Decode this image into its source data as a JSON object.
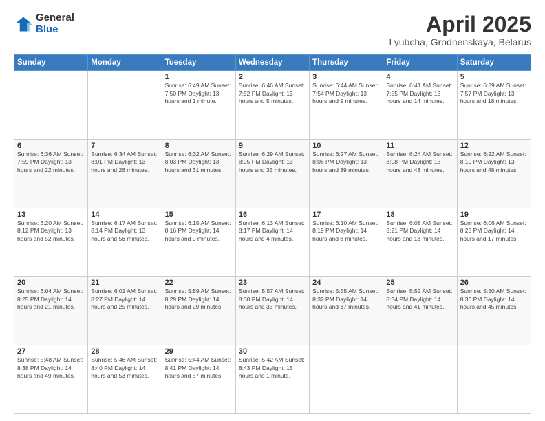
{
  "header": {
    "logo_general": "General",
    "logo_blue": "Blue",
    "title": "April 2025",
    "subtitle": "Lyubcha, Grodnenskaya, Belarus"
  },
  "days_of_week": [
    "Sunday",
    "Monday",
    "Tuesday",
    "Wednesday",
    "Thursday",
    "Friday",
    "Saturday"
  ],
  "weeks": [
    [
      {
        "day": "",
        "info": ""
      },
      {
        "day": "",
        "info": ""
      },
      {
        "day": "1",
        "info": "Sunrise: 6:49 AM\nSunset: 7:50 PM\nDaylight: 13 hours and 1 minute."
      },
      {
        "day": "2",
        "info": "Sunrise: 6:46 AM\nSunset: 7:52 PM\nDaylight: 13 hours and 5 minutes."
      },
      {
        "day": "3",
        "info": "Sunrise: 6:44 AM\nSunset: 7:54 PM\nDaylight: 13 hours and 9 minutes."
      },
      {
        "day": "4",
        "info": "Sunrise: 6:41 AM\nSunset: 7:55 PM\nDaylight: 13 hours and 14 minutes."
      },
      {
        "day": "5",
        "info": "Sunrise: 6:39 AM\nSunset: 7:57 PM\nDaylight: 13 hours and 18 minutes."
      }
    ],
    [
      {
        "day": "6",
        "info": "Sunrise: 6:36 AM\nSunset: 7:59 PM\nDaylight: 13 hours and 22 minutes."
      },
      {
        "day": "7",
        "info": "Sunrise: 6:34 AM\nSunset: 8:01 PM\nDaylight: 13 hours and 26 minutes."
      },
      {
        "day": "8",
        "info": "Sunrise: 6:32 AM\nSunset: 8:03 PM\nDaylight: 13 hours and 31 minutes."
      },
      {
        "day": "9",
        "info": "Sunrise: 6:29 AM\nSunset: 8:05 PM\nDaylight: 13 hours and 35 minutes."
      },
      {
        "day": "10",
        "info": "Sunrise: 6:27 AM\nSunset: 8:06 PM\nDaylight: 13 hours and 39 minutes."
      },
      {
        "day": "11",
        "info": "Sunrise: 6:24 AM\nSunset: 8:08 PM\nDaylight: 13 hours and 43 minutes."
      },
      {
        "day": "12",
        "info": "Sunrise: 6:22 AM\nSunset: 8:10 PM\nDaylight: 13 hours and 48 minutes."
      }
    ],
    [
      {
        "day": "13",
        "info": "Sunrise: 6:20 AM\nSunset: 8:12 PM\nDaylight: 13 hours and 52 minutes."
      },
      {
        "day": "14",
        "info": "Sunrise: 6:17 AM\nSunset: 8:14 PM\nDaylight: 13 hours and 56 minutes."
      },
      {
        "day": "15",
        "info": "Sunrise: 6:15 AM\nSunset: 8:16 PM\nDaylight: 14 hours and 0 minutes."
      },
      {
        "day": "16",
        "info": "Sunrise: 6:13 AM\nSunset: 8:17 PM\nDaylight: 14 hours and 4 minutes."
      },
      {
        "day": "17",
        "info": "Sunrise: 6:10 AM\nSunset: 8:19 PM\nDaylight: 14 hours and 8 minutes."
      },
      {
        "day": "18",
        "info": "Sunrise: 6:08 AM\nSunset: 8:21 PM\nDaylight: 14 hours and 13 minutes."
      },
      {
        "day": "19",
        "info": "Sunrise: 6:06 AM\nSunset: 8:23 PM\nDaylight: 14 hours and 17 minutes."
      }
    ],
    [
      {
        "day": "20",
        "info": "Sunrise: 6:04 AM\nSunset: 8:25 PM\nDaylight: 14 hours and 21 minutes."
      },
      {
        "day": "21",
        "info": "Sunrise: 6:01 AM\nSunset: 8:27 PM\nDaylight: 14 hours and 25 minutes."
      },
      {
        "day": "22",
        "info": "Sunrise: 5:59 AM\nSunset: 8:29 PM\nDaylight: 14 hours and 29 minutes."
      },
      {
        "day": "23",
        "info": "Sunrise: 5:57 AM\nSunset: 8:30 PM\nDaylight: 14 hours and 33 minutes."
      },
      {
        "day": "24",
        "info": "Sunrise: 5:55 AM\nSunset: 8:32 PM\nDaylight: 14 hours and 37 minutes."
      },
      {
        "day": "25",
        "info": "Sunrise: 5:52 AM\nSunset: 8:34 PM\nDaylight: 14 hours and 41 minutes."
      },
      {
        "day": "26",
        "info": "Sunrise: 5:50 AM\nSunset: 8:36 PM\nDaylight: 14 hours and 45 minutes."
      }
    ],
    [
      {
        "day": "27",
        "info": "Sunrise: 5:48 AM\nSunset: 8:38 PM\nDaylight: 14 hours and 49 minutes."
      },
      {
        "day": "28",
        "info": "Sunrise: 5:46 AM\nSunset: 8:40 PM\nDaylight: 14 hours and 53 minutes."
      },
      {
        "day": "29",
        "info": "Sunrise: 5:44 AM\nSunset: 8:41 PM\nDaylight: 14 hours and 57 minutes."
      },
      {
        "day": "30",
        "info": "Sunrise: 5:42 AM\nSunset: 8:43 PM\nDaylight: 15 hours and 1 minute."
      },
      {
        "day": "",
        "info": ""
      },
      {
        "day": "",
        "info": ""
      },
      {
        "day": "",
        "info": ""
      }
    ]
  ]
}
